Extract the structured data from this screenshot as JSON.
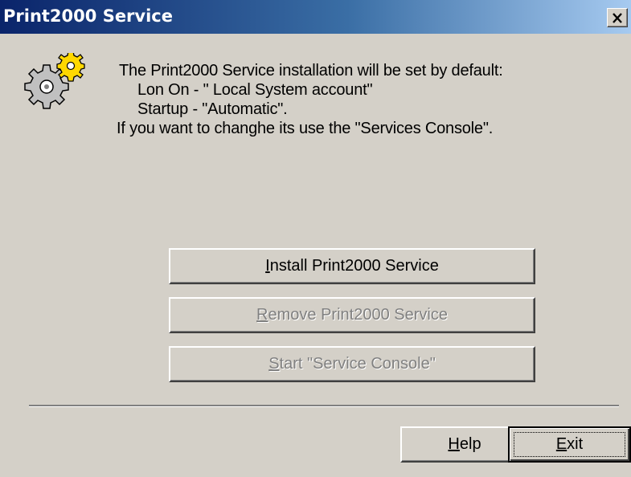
{
  "window": {
    "title": "Print2000 Service",
    "close_symbol": "✕"
  },
  "icon": {
    "name": "gear-icon"
  },
  "message": {
    "line1": "The Print2000 Service installation will be set by default:",
    "line2": "Lon On - \" Local System account\"",
    "line3": "Startup - \"Automatic\".",
    "line4": "If you want to changhe its use the \"Services Console\"."
  },
  "buttons": {
    "install": {
      "accel": "I",
      "rest": "nstall Print2000 Service",
      "enabled": true
    },
    "remove": {
      "accel": "R",
      "rest": "emove Print2000 Service",
      "enabled": false
    },
    "console": {
      "accel": "S",
      "rest": "tart \"Service Console\"",
      "enabled": false
    },
    "help": {
      "accel": "H",
      "rest": "elp",
      "enabled": true
    },
    "exit": {
      "accel": "E",
      "rest": "xit",
      "enabled": true
    }
  },
  "colors": {
    "title_gradient_start": "#0a246a",
    "title_gradient_end": "#a6caf0",
    "face": "#d4d0c8",
    "disabled_text": "#808080"
  }
}
